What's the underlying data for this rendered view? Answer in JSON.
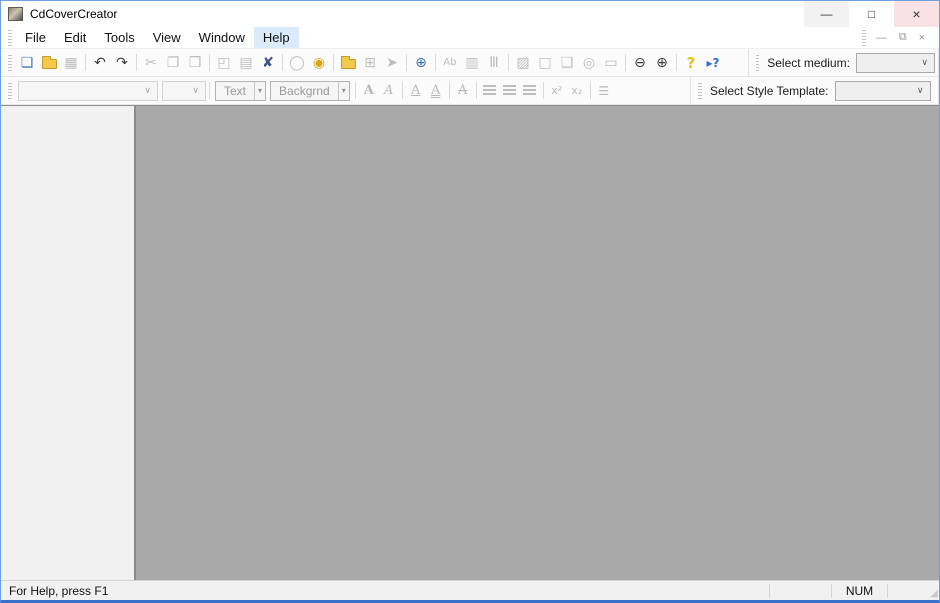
{
  "window": {
    "title": "CdCoverCreator",
    "icons": {
      "minimize": "—",
      "maximize": "□",
      "close": "×"
    }
  },
  "menu": {
    "items": [
      "File",
      "Edit",
      "Tools",
      "View",
      "Window",
      "Help"
    ],
    "active_item": "Help",
    "mdi_icons": {
      "minimize": "—",
      "restore": "⧉",
      "close": "×"
    }
  },
  "toolbar_main": {
    "buttons": [
      {
        "name": "new-document",
        "glyph": "❏",
        "enabled": true
      },
      {
        "name": "open-folder",
        "glyph": "",
        "enabled": true
      },
      {
        "name": "save",
        "glyph": "▦",
        "enabled": false
      },
      {
        "name": "undo",
        "glyph": "↶",
        "enabled": true
      },
      {
        "name": "redo",
        "glyph": "↷",
        "enabled": true
      },
      {
        "name": "cut",
        "glyph": "✂",
        "enabled": false
      },
      {
        "name": "copy",
        "glyph": "❐",
        "enabled": false
      },
      {
        "name": "paste",
        "glyph": "❒",
        "enabled": false
      },
      {
        "name": "print-preview",
        "glyph": "◰",
        "enabled": false
      },
      {
        "name": "print",
        "glyph": "▤",
        "enabled": false
      },
      {
        "name": "delete-cover",
        "glyph": "✘",
        "enabled": true
      },
      {
        "name": "draw-circle",
        "glyph": "◯",
        "enabled": false
      },
      {
        "name": "globe",
        "glyph": "◉",
        "enabled": true
      },
      {
        "name": "search-folder",
        "glyph": "",
        "enabled": true
      },
      {
        "name": "table",
        "glyph": "⊞",
        "enabled": false
      },
      {
        "name": "forward-arrow",
        "glyph": "➤",
        "enabled": false
      },
      {
        "name": "find-in-page",
        "glyph": "⊕",
        "enabled": true
      },
      {
        "name": "text-field",
        "glyph": "Ab",
        "enabled": false
      },
      {
        "name": "frame-grid",
        "glyph": "▥",
        "enabled": false
      },
      {
        "name": "columns",
        "glyph": "Ⅲ",
        "enabled": false
      },
      {
        "name": "image",
        "glyph": "▨",
        "enabled": false
      },
      {
        "name": "frame",
        "glyph": "□",
        "enabled": false
      },
      {
        "name": "filled-frame",
        "glyph": "❑",
        "enabled": false
      },
      {
        "name": "disc",
        "glyph": "◎",
        "enabled": false
      },
      {
        "name": "tray",
        "glyph": "▭",
        "enabled": false
      },
      {
        "name": "zoom-out",
        "glyph": "⊖",
        "enabled": true
      },
      {
        "name": "zoom-in",
        "glyph": "⊕",
        "enabled": true
      },
      {
        "name": "help",
        "glyph": "?",
        "enabled": true
      },
      {
        "name": "context-help",
        "glyph": "▸?",
        "enabled": true
      }
    ],
    "select_medium": {
      "label": "Select medium:",
      "value": "",
      "chevron": "∨"
    }
  },
  "toolbar_format": {
    "font_name_combo": {
      "value": "",
      "chevron": "∨"
    },
    "font_size_combo": {
      "value": "",
      "chevron": "∨"
    },
    "text_dropdown": {
      "label": "Text",
      "arrow": "▾"
    },
    "background_dropdown": {
      "label": "Backgrnd",
      "arrow": "▾"
    },
    "buttons": [
      {
        "name": "bold",
        "glyph": "A"
      },
      {
        "name": "italic",
        "glyph": "A"
      },
      {
        "name": "underline",
        "glyph": "A"
      },
      {
        "name": "underline-double",
        "glyph": "A"
      },
      {
        "name": "strikethrough",
        "glyph": "A"
      },
      {
        "name": "superscript",
        "glyph": "x²"
      },
      {
        "name": "subscript",
        "glyph": "x₂"
      },
      {
        "name": "bullet-list",
        "glyph": "☰"
      }
    ],
    "align_buttons": [
      {
        "name": "align-left"
      },
      {
        "name": "align-center"
      },
      {
        "name": "align-right"
      }
    ],
    "select_style": {
      "label": "Select Style Template:",
      "value": "",
      "chevron": "∨"
    }
  },
  "statusbar": {
    "message": "For Help, press F1",
    "num_indicator": "NUM"
  },
  "colors": {
    "window_border": "#6ea1dc",
    "window_border_bottom": "#3a70c8",
    "menu_highlight": "#dcebfa",
    "close_button_bg": "#f9e2e4",
    "canvas": "#a9a9a9",
    "sidebar": "#f1f1f1",
    "toolbar_band": "#fbfbfb",
    "disabled_icon": "#bdbdbd",
    "help_icon": "#e3c51a",
    "folder_icon": "#f2c94c"
  }
}
